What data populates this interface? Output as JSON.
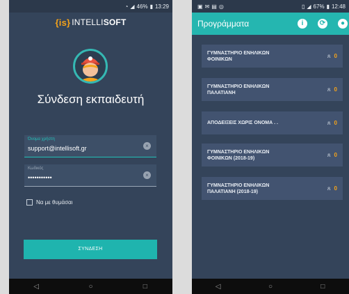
{
  "left": {
    "status": {
      "battery": "46%",
      "time": "13:29"
    },
    "brand": {
      "prefix": "{is}",
      "name_a": "INTELLI",
      "name_b": "SOFT"
    },
    "login_title": "Σύνδεση εκπαιδευτή",
    "username": {
      "label": "Όνομα χρήστη",
      "value": "support@intellisoft.gr"
    },
    "password": {
      "label": "Κωδικός",
      "value": "•••••••••••"
    },
    "remember_label": "Να με θυμάσαι",
    "login_button": "ΣΥΝΔΕΣΗ"
  },
  "right": {
    "status": {
      "battery": "67%",
      "time": "12:48"
    },
    "title": "Προγράμματα",
    "programs": [
      {
        "name_line1": "ΓΥΜΝΑΣΤΗΡΙΟ ΕΝΗΛΙΚΩΝ",
        "name_line2": "ΦΟΙΝΙΚΩΝ",
        "count": "0"
      },
      {
        "name_line1": "ΓΥΜΝΑΣΤΗΡΙΟ ΕΝΗΛΙΚΩΝ",
        "name_line2": "ΠΑΛΑΤΙΑΝΗ",
        "count": "0"
      },
      {
        "name_line1": "ΑΠΟΔΕΙΞΕΙΣ ΧΩΡΙΣ ΟΝΟΜΑ . .",
        "name_line2": "",
        "count": "0"
      },
      {
        "name_line1": "ΓΥΜΝΑΣΤΗΡΙΟ ΕΝΗΛΙΚΩΝ",
        "name_line2": "ΦΟΙΝΙΚΩΝ (2018-19)",
        "count": "0"
      },
      {
        "name_line1": "ΓΥΜΝΑΣΤΗΡΙΟ ΕΝΗΛΙΚΩΝ",
        "name_line2": "ΠΑΛΑΤΙΑΝΗ (2018-19)",
        "count": "0"
      }
    ]
  },
  "colors": {
    "accent": "#25b6b0",
    "count": "#f5a31a",
    "background": "#34445a"
  },
  "icons": [
    "info-icon",
    "sync-icon",
    "account-icon",
    "people-icon",
    "clear-icon"
  ]
}
